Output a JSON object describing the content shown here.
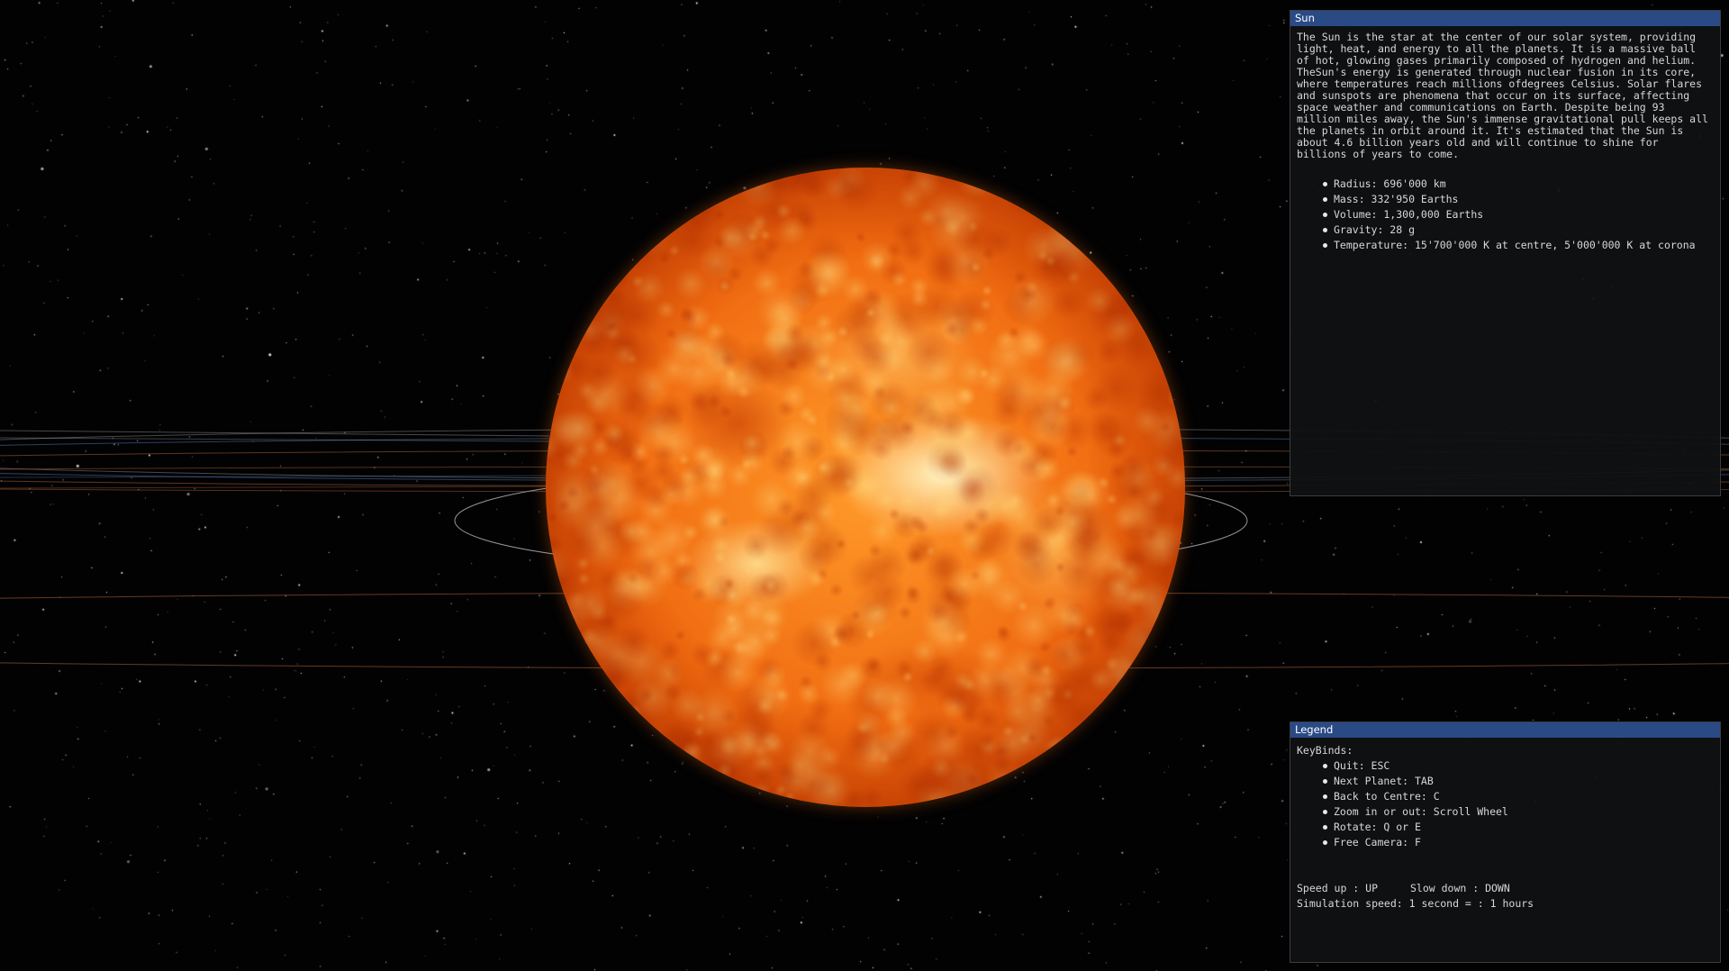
{
  "window": {
    "title": ""
  },
  "scene": {
    "background_color": "#020203",
    "body_name": "Sun",
    "body_colors": {
      "core": "#ff9a2a",
      "mid": "#f06a10",
      "edge": "#b83500"
    }
  },
  "info_panel": {
    "title": "Sun",
    "description": "The Sun is the star at the center of our solar system, providing light, heat, and energy to all the planets. It is a massive ball of hot, glowing gases primarily composed of hydrogen and helium. TheSun's energy is generated through nuclear fusion in its core, where temperatures reach millions ofdegrees Celsius. Solar flares and sunspots are phenomena that occur on its surface, affecting space weather and communications on Earth. Despite being 93 million miles away, the Sun's immense gravitational pull keeps all the planets in orbit around it. It's estimated that the Sun is about 4.6 billion years old and will continue to shine for billions of years to come.",
    "facts": [
      "Radius: 696'000 km",
      "Mass: 332'950 Earths",
      "Volume: 1,300,000 Earths",
      "Gravity: 28 g",
      "Temperature: 15'700'000 K at centre, 5'000'000 K at corona"
    ]
  },
  "legend_panel": {
    "title": "Legend",
    "keybinds_label": "KeyBinds:",
    "keybinds": [
      "Quit: ESC",
      "Next Planet: TAB",
      "Back to Centre: C",
      "Zoom in or out: Scroll Wheel",
      "Rotate: Q or E",
      "Free Camera: F"
    ],
    "speed_up": "Speed up : UP",
    "slow_down": "Slow down : DOWN",
    "simulation_speed": "Simulation speed: 1 second = : 1 hours"
  },
  "colors": {
    "panel_title_bg": "#2a4a86",
    "panel_bg": "#101112",
    "panel_text": "#d8d8d8",
    "orbit_white": "#c8ccd4",
    "orbit_orange": "#b86a3a",
    "orbit_blue": "#4a6a9a"
  }
}
